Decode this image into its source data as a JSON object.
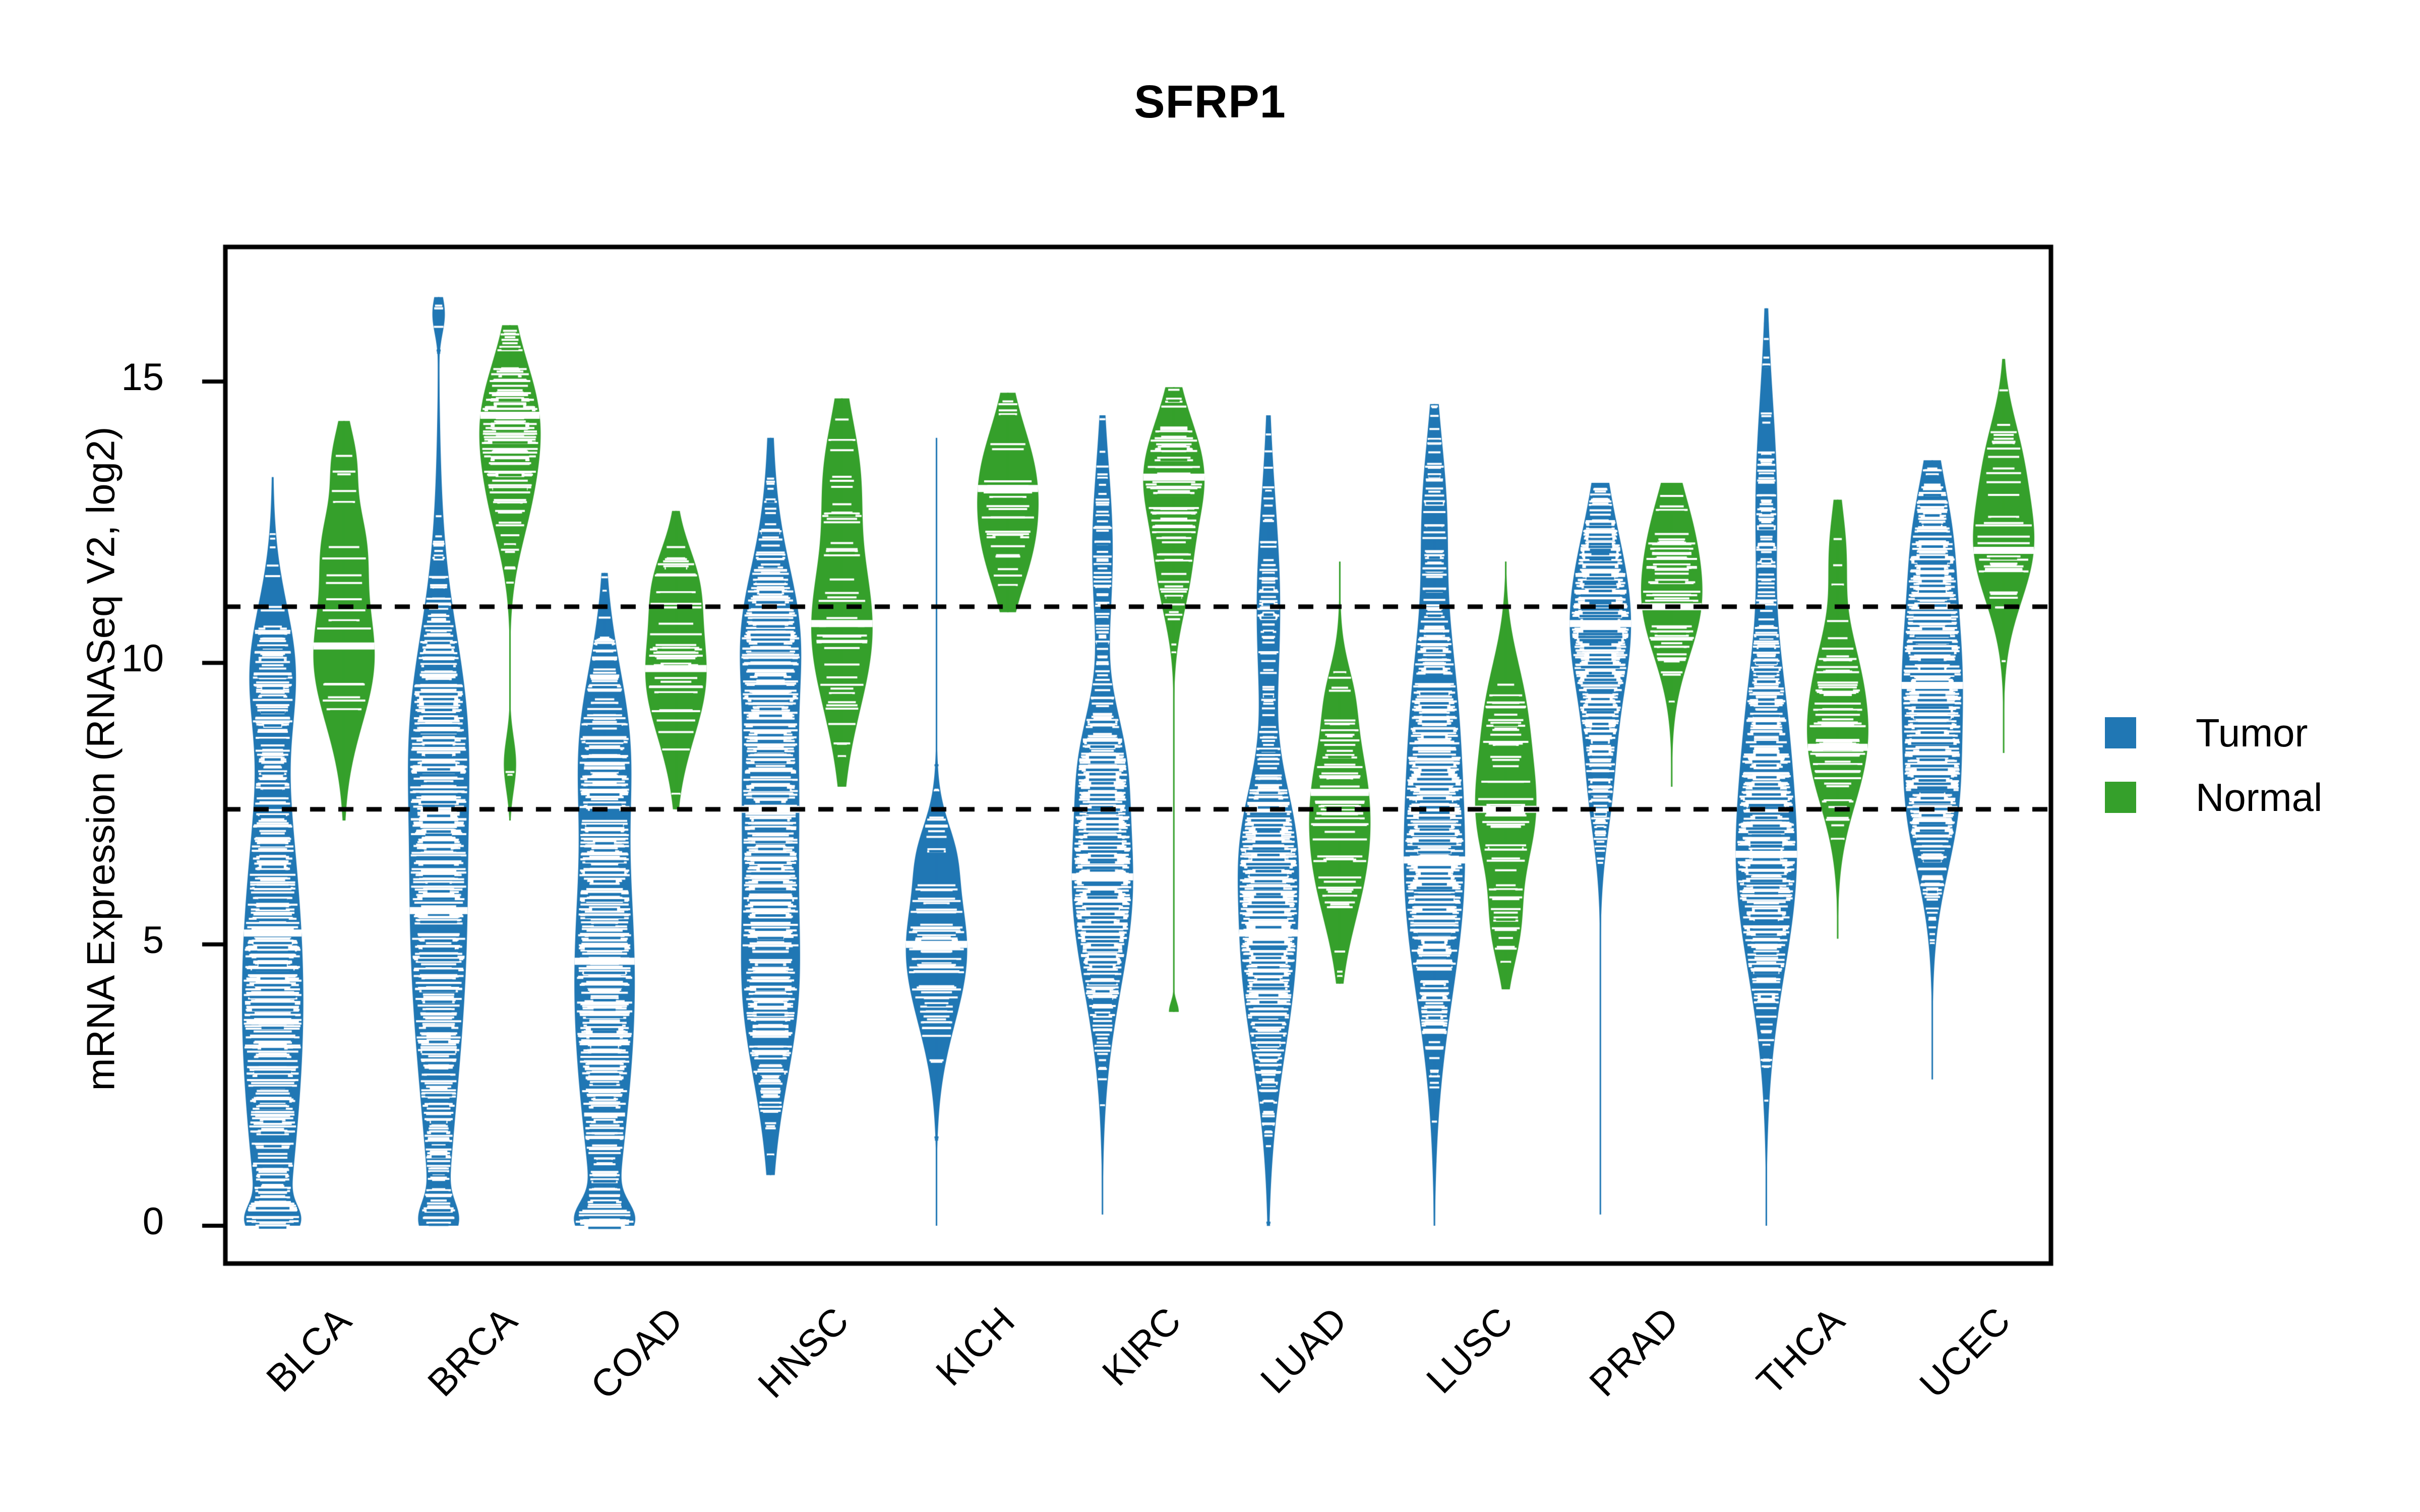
{
  "chart_data": {
    "type": "violin",
    "title": "SFRP1",
    "xlabel": "",
    "ylabel": "mRNA Expression (RNASeq V2, log2)",
    "ylim": [
      -0.7,
      16.8
    ],
    "yticks": [
      0,
      5,
      10,
      15
    ],
    "ytick_labels": [
      "0",
      "5",
      "10",
      "15"
    ],
    "grid": false,
    "legend_position": "right",
    "reference_lines": [
      11.0,
      7.4
    ],
    "reference_line_style": "dotted",
    "categories": [
      "BLCA",
      "BRCA",
      "COAD",
      "HNSC",
      "KICH",
      "KIRC",
      "LUAD",
      "LUSC",
      "PRAD",
      "THCA",
      "UCEC"
    ],
    "series": [
      {
        "name": "Tumor",
        "color": "#2077b4",
        "groups": [
          {
            "category": "BLCA",
            "median": 5.2,
            "q1": 2.6,
            "q3": 9.6,
            "min": 0.0,
            "max": 13.3,
            "n": 408,
            "modes": [
              {
                "center": 4.0,
                "spread": 2.9,
                "weight": 1.0
              },
              {
                "center": 9.9,
                "spread": 1.0,
                "weight": 0.55
              },
              {
                "center": 0.1,
                "spread": 0.25,
                "weight": 0.5
              }
            ]
          },
          {
            "category": "BRCA",
            "median": 5.6,
            "q1": 3.0,
            "q3": 9.1,
            "min": 0.0,
            "max": 16.5,
            "n": 1100,
            "modes": [
              {
                "center": 5.6,
                "spread": 3.0,
                "weight": 1.0
              },
              {
                "center": 9.0,
                "spread": 1.4,
                "weight": 0.5
              },
              {
                "center": 0.1,
                "spread": 0.3,
                "weight": 0.45
              },
              {
                "center": 16.2,
                "spread": 0.3,
                "weight": 0.12
              }
            ]
          },
          {
            "category": "COAD",
            "median": 4.7,
            "q1": 2.5,
            "q3": 8.4,
            "min": 0.0,
            "max": 11.6,
            "n": 380,
            "modes": [
              {
                "center": 4.3,
                "spread": 2.6,
                "weight": 1.0
              },
              {
                "center": 8.6,
                "spread": 1.2,
                "weight": 0.55
              },
              {
                "center": 0.1,
                "spread": 0.3,
                "weight": 0.75
              }
            ]
          },
          {
            "category": "HNSC",
            "median": 7.4,
            "q1": 4.4,
            "q3": 9.8,
            "min": 0.9,
            "max": 14.0,
            "n": 520,
            "modes": [
              {
                "center": 7.6,
                "spread": 2.6,
                "weight": 1.0
              },
              {
                "center": 10.6,
                "spread": 1.0,
                "weight": 0.55
              },
              {
                "center": 4.0,
                "spread": 1.3,
                "weight": 0.6
              }
            ]
          },
          {
            "category": "KICH",
            "median": 5.0,
            "q1": 4.1,
            "q3": 6.1,
            "min": 0.0,
            "max": 14.0,
            "n": 66,
            "modes": [
              {
                "center": 4.9,
                "spread": 1.1,
                "weight": 1.0
              },
              {
                "center": 6.6,
                "spread": 0.5,
                "weight": 0.28
              }
            ]
          },
          {
            "category": "KIRC",
            "median": 6.2,
            "q1": 4.6,
            "q3": 7.8,
            "min": 0.2,
            "max": 14.4,
            "n": 530,
            "modes": [
              {
                "center": 6.1,
                "spread": 1.6,
                "weight": 1.0
              },
              {
                "center": 8.3,
                "spread": 0.8,
                "weight": 0.35
              },
              {
                "center": 12.0,
                "spread": 1.3,
                "weight": 0.22
              }
            ]
          },
          {
            "category": "LUAD",
            "median": 5.2,
            "q1": 3.6,
            "q3": 7.2,
            "min": 0.0,
            "max": 14.4,
            "n": 517,
            "modes": [
              {
                "center": 5.1,
                "spread": 1.7,
                "weight": 1.0
              },
              {
                "center": 6.9,
                "spread": 0.9,
                "weight": 0.45
              },
              {
                "center": 11.0,
                "spread": 1.6,
                "weight": 0.3
              }
            ]
          },
          {
            "category": "LUSC",
            "median": 6.5,
            "q1": 4.6,
            "q3": 8.3,
            "min": 0.0,
            "max": 14.6,
            "n": 501,
            "modes": [
              {
                "center": 6.3,
                "spread": 1.9,
                "weight": 1.0
              },
              {
                "center": 9.4,
                "spread": 1.4,
                "weight": 0.45
              },
              {
                "center": 12.6,
                "spread": 1.2,
                "weight": 0.28
              }
            ]
          },
          {
            "category": "PRAD",
            "median": 10.7,
            "q1": 9.6,
            "q3": 11.6,
            "min": 0.2,
            "max": 13.2,
            "n": 498,
            "modes": [
              {
                "center": 10.7,
                "spread": 1.35,
                "weight": 1.0
              },
              {
                "center": 7.9,
                "spread": 0.9,
                "weight": 0.22
              }
            ]
          },
          {
            "category": "THCA",
            "median": 6.6,
            "q1": 5.1,
            "q3": 7.9,
            "min": 0.0,
            "max": 16.3,
            "n": 513,
            "modes": [
              {
                "center": 6.5,
                "spread": 1.7,
                "weight": 1.0
              },
              {
                "center": 9.2,
                "spread": 1.2,
                "weight": 0.3
              },
              {
                "center": 12.8,
                "spread": 1.6,
                "weight": 0.24
              }
            ]
          },
          {
            "category": "UCEC",
            "median": 9.6,
            "q1": 7.5,
            "q3": 10.8,
            "min": 2.6,
            "max": 13.6,
            "n": 540,
            "modes": [
              {
                "center": 9.7,
                "spread": 1.7,
                "weight": 1.0
              },
              {
                "center": 7.3,
                "spread": 1.0,
                "weight": 0.45
              },
              {
                "center": 12.3,
                "spread": 0.9,
                "weight": 0.3
              }
            ]
          }
        ]
      },
      {
        "name": "Normal",
        "color": "#35a02b",
        "groups": [
          {
            "category": "BLCA",
            "median": 10.3,
            "q1": 9.6,
            "q3": 11.3,
            "min": 7.2,
            "max": 14.3,
            "n": 19,
            "modes": [
              {
                "center": 10.1,
                "spread": 1.0,
                "weight": 1.0
              },
              {
                "center": 12.1,
                "spread": 0.7,
                "weight": 0.55
              },
              {
                "center": 13.6,
                "spread": 0.5,
                "weight": 0.25
              }
            ]
          },
          {
            "category": "BRCA",
            "median": 14.4,
            "q1": 13.4,
            "q3": 15.0,
            "min": 7.2,
            "max": 16.0,
            "n": 112,
            "modes": [
              {
                "center": 14.3,
                "spread": 0.9,
                "weight": 1.0
              },
              {
                "center": 12.9,
                "spread": 0.8,
                "weight": 0.45
              },
              {
                "center": 8.2,
                "spread": 0.4,
                "weight": 0.12
              }
            ]
          },
          {
            "category": "COAD",
            "median": 9.9,
            "q1": 9.1,
            "q3": 10.7,
            "min": 7.4,
            "max": 12.7,
            "n": 41,
            "modes": [
              {
                "center": 9.8,
                "spread": 0.95,
                "weight": 1.0
              },
              {
                "center": 11.4,
                "spread": 0.6,
                "weight": 0.5
              }
            ]
          },
          {
            "category": "HNSC",
            "median": 10.7,
            "q1": 9.6,
            "q3": 11.8,
            "min": 7.8,
            "max": 14.7,
            "n": 44,
            "modes": [
              {
                "center": 10.6,
                "spread": 1.2,
                "weight": 1.0
              },
              {
                "center": 13.3,
                "spread": 0.9,
                "weight": 0.45
              }
            ]
          },
          {
            "category": "KICH",
            "median": 13.1,
            "q1": 12.4,
            "q3": 13.9,
            "min": 10.9,
            "max": 14.8,
            "n": 25,
            "modes": [
              {
                "center": 13.2,
                "spread": 0.85,
                "weight": 1.0
              },
              {
                "center": 12.0,
                "spread": 0.7,
                "weight": 0.55
              }
            ]
          },
          {
            "category": "KIRC",
            "median": 13.3,
            "q1": 12.5,
            "q3": 14.0,
            "min": 3.8,
            "max": 14.9,
            "n": 72,
            "modes": [
              {
                "center": 13.3,
                "spread": 0.85,
                "weight": 1.0
              },
              {
                "center": 11.6,
                "spread": 0.7,
                "weight": 0.35
              },
              {
                "center": 3.8,
                "spread": 0.15,
                "weight": 0.08
              }
            ]
          },
          {
            "category": "LUAD",
            "median": 7.7,
            "q1": 6.7,
            "q3": 8.5,
            "min": 4.3,
            "max": 11.8,
            "n": 58,
            "modes": [
              {
                "center": 7.6,
                "spread": 1.1,
                "weight": 1.0
              },
              {
                "center": 6.2,
                "spread": 0.9,
                "weight": 0.5
              },
              {
                "center": 9.4,
                "spread": 0.5,
                "weight": 0.22
              }
            ]
          },
          {
            "category": "LUSC",
            "median": 7.4,
            "q1": 6.8,
            "q3": 8.4,
            "min": 4.2,
            "max": 11.8,
            "n": 51,
            "modes": [
              {
                "center": 7.4,
                "spread": 1.0,
                "weight": 1.0
              },
              {
                "center": 9.2,
                "spread": 0.8,
                "weight": 0.45
              },
              {
                "center": 5.3,
                "spread": 0.6,
                "weight": 0.3
              }
            ]
          },
          {
            "category": "PRAD",
            "median": 11.0,
            "q1": 10.4,
            "q3": 11.6,
            "min": 7.8,
            "max": 13.2,
            "n": 52,
            "modes": [
              {
                "center": 11.1,
                "spread": 0.85,
                "weight": 1.0
              },
              {
                "center": 12.4,
                "spread": 0.7,
                "weight": 0.4
              }
            ]
          },
          {
            "category": "THCA",
            "median": 8.5,
            "q1": 7.8,
            "q3": 9.2,
            "min": 5.1,
            "max": 12.9,
            "n": 59,
            "modes": [
              {
                "center": 8.5,
                "spread": 0.9,
                "weight": 1.0
              },
              {
                "center": 9.8,
                "spread": 0.8,
                "weight": 0.5
              },
              {
                "center": 11.9,
                "spread": 0.7,
                "weight": 0.2
              }
            ]
          },
          {
            "category": "UCEC",
            "median": 12.0,
            "q1": 11.4,
            "q3": 12.8,
            "min": 8.4,
            "max": 15.4,
            "n": 35,
            "modes": [
              {
                "center": 12.1,
                "spread": 0.85,
                "weight": 1.0
              },
              {
                "center": 13.6,
                "spread": 0.7,
                "weight": 0.4
              }
            ]
          }
        ]
      }
    ]
  },
  "title": {
    "text": "SFRP1"
  },
  "axes": {
    "y_title": "mRNA Expression (RNASeq V2, log2)",
    "y_tick_labels": [
      "15",
      "10",
      "5",
      "0"
    ],
    "x_tick_labels": [
      "BLCA",
      "BRCA",
      "COAD",
      "HNSC",
      "KICH",
      "KIRC",
      "LUAD",
      "LUSC",
      "PRAD",
      "THCA",
      "UCEC"
    ]
  },
  "legend": {
    "items": [
      {
        "label": "Tumor",
        "color": "#2077b4"
      },
      {
        "label": "Normal",
        "color": "#35a02b"
      }
    ]
  },
  "colors": {
    "tumor": "#2077b4",
    "normal": "#35a02b",
    "axis": "#000000",
    "background": "#ffffff"
  }
}
